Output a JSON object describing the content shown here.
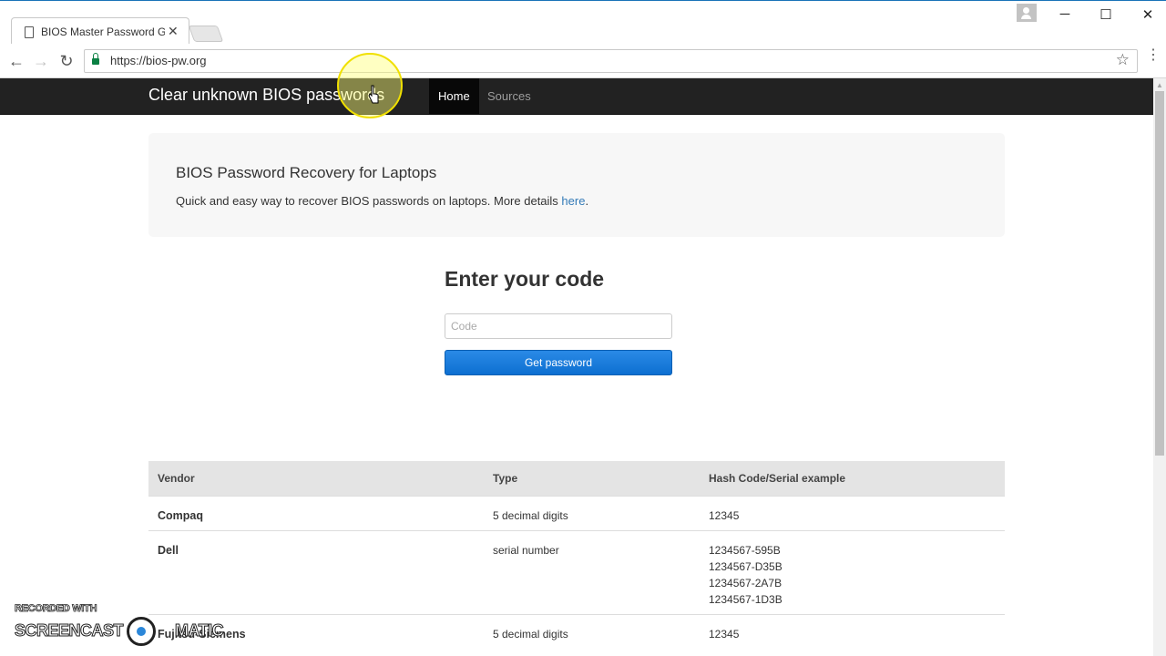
{
  "browser": {
    "tab_title": "BIOS Master Password G",
    "url": "https://bios-pw.org",
    "window_controls": {
      "minimize": "─",
      "maximize": "☐",
      "close": "✕"
    },
    "nav": {
      "back": "←",
      "forward": "→",
      "reload": "↻",
      "star": "☆",
      "menu": "⋮"
    }
  },
  "navbar": {
    "brand": "Clear unknown BIOS passwords",
    "items": [
      {
        "label": "Home",
        "active": true
      },
      {
        "label": "Sources",
        "active": false
      }
    ]
  },
  "jumbotron": {
    "title": "BIOS Password Recovery for Laptops",
    "text": "Quick and easy way to recover BIOS passwords on laptops. More details ",
    "link": "here",
    "suffix": "."
  },
  "form": {
    "heading": "Enter your code",
    "placeholder": "Code",
    "button": "Get password"
  },
  "table": {
    "headers": [
      "Vendor",
      "Type",
      "Hash Code/Serial example"
    ],
    "rows": [
      {
        "vendor": "Compaq",
        "type": "5 decimal digits",
        "examples": [
          "12345"
        ]
      },
      {
        "vendor": "Dell",
        "type": "serial number",
        "examples": [
          "1234567-595B",
          "1234567-D35B",
          "1234567-2A7B",
          "1234567-1D3B"
        ]
      },
      {
        "vendor": "Fujitsu-Siemens",
        "type": "5 decimal digits",
        "examples": [
          "12345"
        ]
      }
    ]
  },
  "watermark": {
    "line1": "RECORDED WITH",
    "line2a": "SCREENCAST",
    "line2b": "MATIC"
  },
  "colors": {
    "navbar_bg": "#222222",
    "button_blue": "#0d6fd1",
    "link": "#337ab7",
    "jumbotron_bg": "#f7f7f7",
    "table_header_bg": "#e4e4e4"
  }
}
